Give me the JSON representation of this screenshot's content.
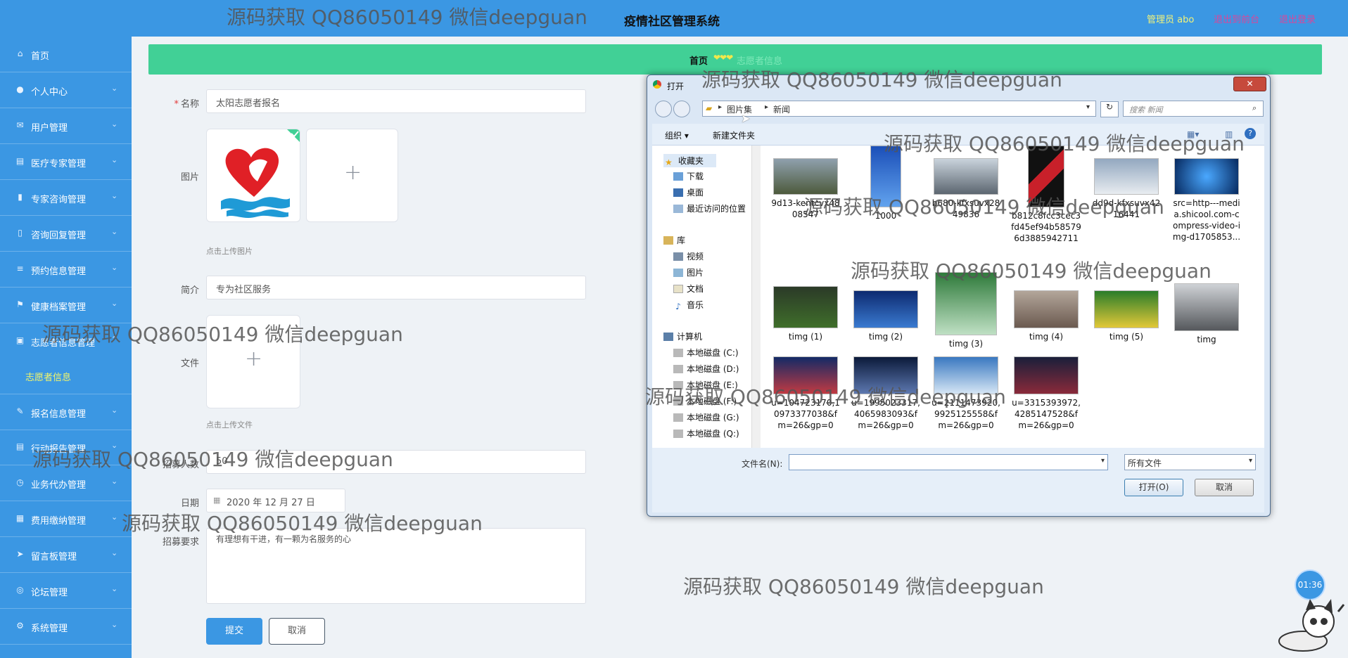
{
  "header": {
    "system_title": "疫情社区管理系统",
    "admin_label": "管理员 abo",
    "back_to_front": "退出到前台",
    "logout": "退出登录"
  },
  "sidebar": {
    "items": [
      {
        "label": "首页",
        "icon": "home-icon"
      },
      {
        "label": "个人中心",
        "icon": "user-icon"
      },
      {
        "label": "用户管理",
        "icon": "mail-icon"
      },
      {
        "label": "医疗专家管理",
        "icon": "doc-icon"
      },
      {
        "label": "专家咨询管理",
        "icon": "bar-chart-icon"
      },
      {
        "label": "咨询回复管理",
        "icon": "phone-icon"
      },
      {
        "label": "预约信息管理",
        "icon": "list-icon"
      },
      {
        "label": "健康档案管理",
        "icon": "flag-icon"
      },
      {
        "label": "志愿者信息管理",
        "icon": "volunteer-icon"
      }
    ],
    "sub_item": "志愿者信息",
    "items2": [
      {
        "label": "报名信息管理",
        "icon": "edit-icon"
      },
      {
        "label": "行动报告管理",
        "icon": "report-icon"
      },
      {
        "label": "业务代办管理",
        "icon": "clock-icon"
      },
      {
        "label": "费用缴纳管理",
        "icon": "money-icon"
      },
      {
        "label": "留言板管理",
        "icon": "send-icon"
      },
      {
        "label": "论坛管理",
        "icon": "forum-icon"
      },
      {
        "label": "系统管理",
        "icon": "settings-icon"
      }
    ]
  },
  "breadcrumb": {
    "home": "首页",
    "current": "志愿者信息"
  },
  "form": {
    "name_label": "名称",
    "name_value": "太阳志愿者报名",
    "image_label": "图片",
    "image_hint": "点击上传图片",
    "intro_label": "简介",
    "intro_value": "专为社区服务",
    "file_label": "文件",
    "file_hint": "点击上传文件",
    "count_label": "招募人数",
    "count_value": "50",
    "date_label": "日期",
    "date_value": "2020 年 12 月 27 日",
    "req_label": "招募要求",
    "req_value": "有理想有干进，有一颗为名服务的心",
    "submit": "提交",
    "cancel": "取消"
  },
  "dialog": {
    "title": "打开",
    "path": [
      "图片集",
      "新闻"
    ],
    "search_placeholder": "搜索 新闻",
    "organize": "组织 ▾",
    "new_folder": "新建文件夹",
    "nav": {
      "favorites": "收藏夹",
      "fav_items": [
        "下载",
        "桌面",
        "最近访问的位置"
      ],
      "library": "库",
      "lib_items": [
        "视频",
        "图片",
        "文档",
        "音乐"
      ],
      "computer": "计算机",
      "drives": [
        "本地磁盘 (C:)",
        "本地磁盘 (D:)",
        "本地磁盘 (E:)",
        "本地磁盘 (F:)",
        "本地磁盘 (G:)",
        "本地磁盘 (Q:)"
      ]
    },
    "files": [
      "9d13-kentcvx4808547",
      "1000",
      "b680-kfxsuvx2849836",
      "b812c8fcc3cec3fd45ef94b585796d3885942711",
      "dd9d-kfxsuvx4216441",
      "src=http---media.shicool.com-compress-video-img-d1705853...",
      "timg (1)",
      "timg (2)",
      "timg (3)",
      "timg (4)",
      "timg (5)",
      "timg",
      "u=104723170,10973377038&fm=26&gp=0",
      "u=1995023317,4065983093&fm=26&gp=0",
      "u=2111473920,9925125558&fm=26&gp=0",
      "u=3315393972,4285147528&fm=26&gp=0"
    ],
    "filename_label": "文件名(N):",
    "filename_value": "",
    "filetype": "所有文件",
    "open": "打开(O)",
    "cancel": "取消"
  },
  "timer": "01:36",
  "watermark": "源码获取 QQ86050149 微信deepguan",
  "colors": {
    "primary": "#3b97e3",
    "breadcrumb": "#41d096",
    "admin": "#f1f37a",
    "link": "#d9479a"
  }
}
